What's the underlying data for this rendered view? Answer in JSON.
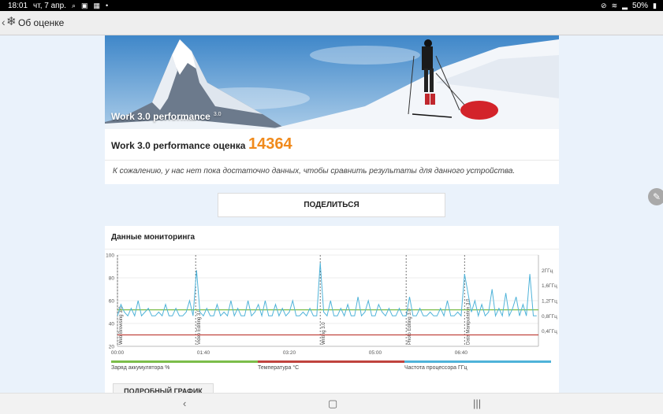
{
  "statusbar": {
    "time": "18:01",
    "date": "чт, 7 апр.",
    "battery": "50%"
  },
  "appbar": {
    "title": "Об оценке",
    "back_icon": "back-chevron-icon",
    "logo_icon": "snowflake-logo-icon"
  },
  "hero": {
    "label": "Work 3.0 performance",
    "version": "3.0"
  },
  "score": {
    "name": "Work 3.0 performance оценка",
    "value": "14364",
    "color": "#f08a1c"
  },
  "note": "К сожалению, у нас нет пока достаточно данных, чтобы сравнить результаты для данного устройства.",
  "share_label": "ПОДЕЛИТЬСЯ",
  "monitoring": {
    "title": "Данные мониторинга",
    "legend": [
      {
        "label": "Заряд аккумулятора %",
        "color": "#7cbd4a"
      },
      {
        "label": "Температура °C",
        "color": "#c0433e"
      },
      {
        "label": "Частота процессора ГГц",
        "color": "#4fb3d9"
      }
    ]
  },
  "detail_label": "ПОДРОБНЫЙ ГРАФИК",
  "chart_data": {
    "type": "line",
    "x_ticks": [
      "00:00",
      "01:40",
      "03:20",
      "05:00",
      "06:40"
    ],
    "y_left_ticks": [
      "20",
      "40",
      "60",
      "80",
      "100"
    ],
    "y_right_ticks": [
      "0,4ГГц",
      "0,8ГГц",
      "1,2ГГц",
      "1,6ГГц",
      "2ГГц"
    ],
    "ylim_left": [
      20,
      100
    ],
    "ylim_right_ghz": [
      0,
      2.4
    ],
    "x_range_sec": [
      0,
      490
    ],
    "markers": [
      {
        "label": "Web Browsing 3.0",
        "t": 0
      },
      {
        "label": "Video Editing 3.0",
        "t": 91
      },
      {
        "label": "Writing 3.0",
        "t": 236
      },
      {
        "label": "Photo Editing 3.0",
        "t": 336
      },
      {
        "label": "Data Manipulation 3.0",
        "t": 404
      }
    ],
    "series": [
      {
        "name": "Заряд аккумулятора %",
        "color": "#7cbd4a",
        "t": [
          0,
          490
        ],
        "values": [
          52,
          52
        ]
      },
      {
        "name": "Температура °C",
        "color": "#c0433e",
        "t": [
          0,
          490
        ],
        "values": [
          30,
          30
        ]
      },
      {
        "name": "Частота процессора ГГц",
        "color": "#4fb3d9",
        "t": [
          0,
          4,
          8,
          12,
          16,
          20,
          24,
          28,
          32,
          36,
          40,
          44,
          48,
          52,
          56,
          60,
          64,
          68,
          72,
          76,
          80,
          84,
          88,
          92,
          96,
          100,
          104,
          108,
          112,
          116,
          120,
          124,
          128,
          132,
          136,
          140,
          144,
          148,
          152,
          156,
          160,
          164,
          168,
          172,
          176,
          180,
          184,
          188,
          192,
          196,
          200,
          204,
          208,
          212,
          216,
          220,
          224,
          228,
          232,
          236,
          240,
          244,
          248,
          252,
          256,
          260,
          264,
          268,
          272,
          276,
          280,
          284,
          288,
          292,
          296,
          300,
          304,
          308,
          312,
          316,
          320,
          324,
          328,
          332,
          336,
          340,
          344,
          348,
          352,
          356,
          360,
          364,
          368,
          372,
          376,
          380,
          384,
          388,
          392,
          396,
          400,
          404,
          408,
          412,
          416,
          420,
          424,
          428,
          432,
          436,
          440,
          444,
          448,
          452,
          456,
          460,
          464,
          468,
          472,
          476,
          480,
          484,
          488
        ],
        "values": [
          0.8,
          1.1,
          0.9,
          0.8,
          1.0,
          0.8,
          1.2,
          0.8,
          0.9,
          1.0,
          0.8,
          0.8,
          0.9,
          0.8,
          1.1,
          0.8,
          0.8,
          1.0,
          0.8,
          0.8,
          0.9,
          1.2,
          0.8,
          2.0,
          0.9,
          0.8,
          1.0,
          0.8,
          0.8,
          1.1,
          0.8,
          0.9,
          0.8,
          1.2,
          0.8,
          1.0,
          0.8,
          0.8,
          1.2,
          0.8,
          0.9,
          1.1,
          0.8,
          1.2,
          0.8,
          0.8,
          1.1,
          0.8,
          1.0,
          0.8,
          0.9,
          1.2,
          0.8,
          0.8,
          0.9,
          0.8,
          1.0,
          0.8,
          0.8,
          2.2,
          0.9,
          0.8,
          1.2,
          0.8,
          0.8,
          1.0,
          0.8,
          1.1,
          0.8,
          0.8,
          1.3,
          0.8,
          0.9,
          1.2,
          0.8,
          0.8,
          1.1,
          0.9,
          0.8,
          1.0,
          0.8,
          0.8,
          1.0,
          0.8,
          0.8,
          1.3,
          0.8,
          0.8,
          1.0,
          0.8,
          0.8,
          0.9,
          0.8,
          0.8,
          1.0,
          0.8,
          1.2,
          0.8,
          0.8,
          0.9,
          0.8,
          1.9,
          1.4,
          0.9,
          1.2,
          0.8,
          1.1,
          0.8,
          0.9,
          1.5,
          0.8,
          1.0,
          0.8,
          1.4,
          0.8,
          1.0,
          1.3,
          0.8,
          1.1,
          0.8,
          1.9,
          0.8,
          0.8
        ]
      }
    ]
  }
}
